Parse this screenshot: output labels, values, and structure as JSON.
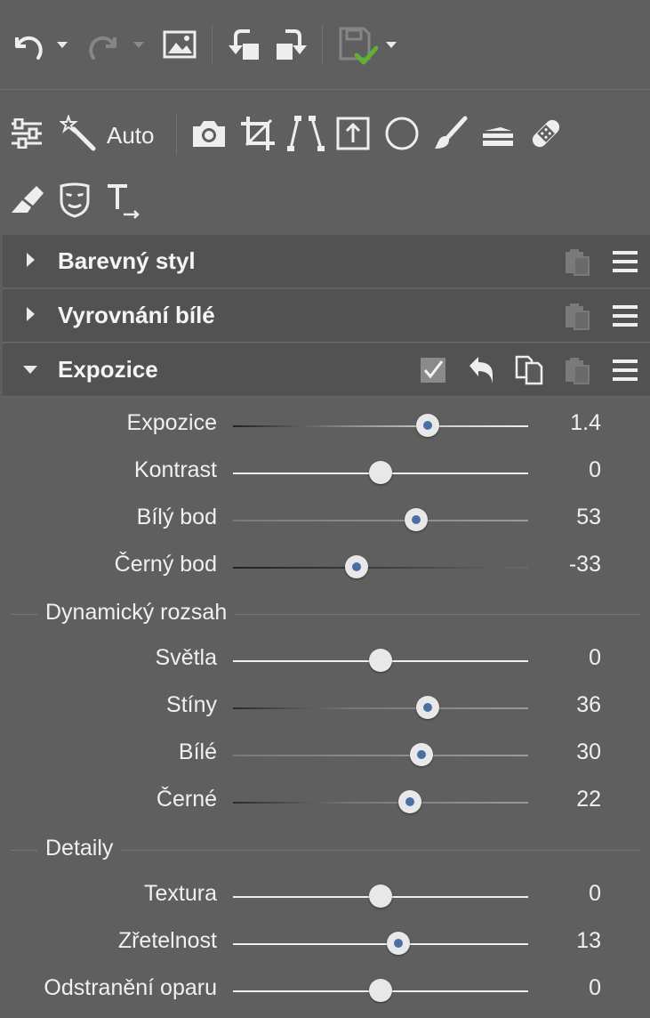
{
  "toolbar": {
    "icons": [
      "undo-icon",
      "redo-icon",
      "image-icon",
      "rotate-left-icon",
      "rotate-right-icon",
      "save-icon"
    ],
    "auto_label": "Auto"
  },
  "tools": [
    "adjustments-icon",
    "magic-wand-icon",
    "camera-icon",
    "crop-icon",
    "perspective-icon",
    "upright-icon",
    "circle-mask-icon",
    "brush-icon",
    "gradient-icon",
    "healing-icon",
    "eraser-icon",
    "mask-face-icon",
    "text-icon"
  ],
  "sections": [
    {
      "title": "Barevný styl",
      "expanded": false
    },
    {
      "title": "Vyrovnání bílé",
      "expanded": false
    },
    {
      "title": "Expozice",
      "expanded": true
    }
  ],
  "exposure": {
    "sliders": [
      {
        "label": "Expozice",
        "value": "1.4",
        "position": 0.66,
        "active": true
      },
      {
        "label": "Kontrast",
        "value": "0",
        "position": 0.5,
        "active": false
      },
      {
        "label": "Bílý bod",
        "value": "53",
        "position": 0.62,
        "active": true
      },
      {
        "label": "Černý bod",
        "value": "-33",
        "position": 0.42,
        "active": true
      }
    ],
    "dynamic_range": {
      "title": "Dynamický rozsah",
      "sliders": [
        {
          "label": "Světla",
          "value": "0",
          "position": 0.5,
          "active": false
        },
        {
          "label": "Stíny",
          "value": "36",
          "position": 0.66,
          "active": true
        },
        {
          "label": "Bílé",
          "value": "30",
          "position": 0.64,
          "active": true
        },
        {
          "label": "Černé",
          "value": "22",
          "position": 0.6,
          "active": true
        }
      ]
    },
    "details": {
      "title": "Detaily",
      "sliders": [
        {
          "label": "Textura",
          "value": "0",
          "position": 0.5,
          "active": false
        },
        {
          "label": "Zřetelnost",
          "value": "13",
          "position": 0.56,
          "active": true
        },
        {
          "label": "Odstranění oparu",
          "value": "0",
          "position": 0.5,
          "active": false
        }
      ]
    }
  },
  "colors": {
    "accent_dot": "#4a6fa5",
    "panel": "#5f5f5f",
    "section_header": "#525252",
    "save_check": "#5fb034"
  }
}
